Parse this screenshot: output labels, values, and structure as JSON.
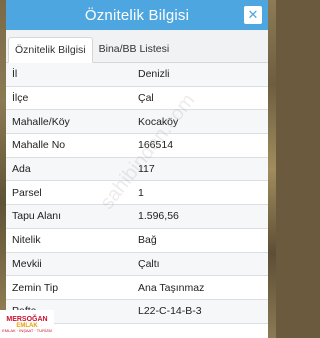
{
  "panel": {
    "title": "Öznitelik Bilgisi",
    "close_symbol": "✕",
    "close_icon": "close-icon"
  },
  "tabs": [
    {
      "label": "Öznitelik Bilgisi",
      "active": true
    },
    {
      "label": "Bina/BB Listesi",
      "active": false
    }
  ],
  "attributes": [
    {
      "key": "İl",
      "value": "Denizli"
    },
    {
      "key": "İlçe",
      "value": "Çal"
    },
    {
      "key": "Mahalle/Köy",
      "value": "Kocaköy"
    },
    {
      "key": "Mahalle No",
      "value": "166514"
    },
    {
      "key": "Ada",
      "value": "117"
    },
    {
      "key": "Parsel",
      "value": "1"
    },
    {
      "key": "Tapu Alanı",
      "value": "1.596,56"
    },
    {
      "key": "Nitelik",
      "value": "Bağ"
    },
    {
      "key": "Mevkii",
      "value": "Çaltı"
    },
    {
      "key": "Zemin Tip",
      "value": "Ana Taşınmaz"
    },
    {
      "key": "Pafta",
      "value": "L22-C-14-B-3"
    }
  ],
  "watermark": "sahibinden.com",
  "logo": {
    "line1": "MERSOĞAN",
    "line2": "EMLAK",
    "line3": "EMLAK · İNŞAAT · TURİZM"
  },
  "colors": {
    "title_bar": "#4ea6e0",
    "logo_red": "#c8102e",
    "logo_gold": "#e8a000"
  }
}
